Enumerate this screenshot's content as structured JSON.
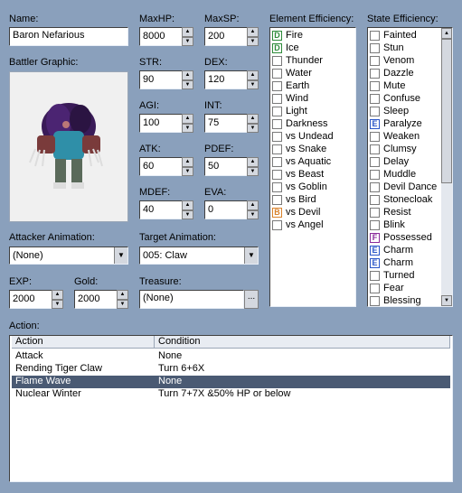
{
  "labels": {
    "name": "Name:",
    "maxhp": "MaxHP:",
    "maxsp": "MaxSP:",
    "element": "Element Efficiency:",
    "state": "State Efficiency:",
    "graphic": "Battler Graphic:",
    "str": "STR:",
    "dex": "DEX:",
    "agi": "AGI:",
    "int": "INT:",
    "atk": "ATK:",
    "pdef": "PDEF:",
    "mdef": "MDEF:",
    "eva": "EVA:",
    "attacker_anim": "Attacker Animation:",
    "target_anim": "Target Animation:",
    "exp": "EXP:",
    "gold": "Gold:",
    "treasure": "Treasure:",
    "action": "Action:"
  },
  "values": {
    "name": "Baron Nefarious",
    "maxhp": "8000",
    "maxsp": "200",
    "str": "90",
    "dex": "120",
    "agi": "100",
    "int": "75",
    "atk": "60",
    "pdef": "50",
    "mdef": "40",
    "eva": "0",
    "attacker_anim": "(None)",
    "target_anim": "005: Claw",
    "exp": "2000",
    "gold": "2000",
    "treasure": "(None)",
    "treasure_button": "..."
  },
  "elements": [
    {
      "label": "Fire",
      "mark": "D",
      "color": "#2e8b3a"
    },
    {
      "label": "Ice",
      "mark": "D",
      "color": "#2e8b3a"
    },
    {
      "label": "Thunder",
      "mark": "",
      "color": ""
    },
    {
      "label": "Water",
      "mark": "",
      "color": ""
    },
    {
      "label": "Earth",
      "mark": "",
      "color": ""
    },
    {
      "label": "Wind",
      "mark": "",
      "color": ""
    },
    {
      "label": "Light",
      "mark": "",
      "color": ""
    },
    {
      "label": "Darkness",
      "mark": "",
      "color": ""
    },
    {
      "label": "vs Undead",
      "mark": "",
      "color": ""
    },
    {
      "label": "vs Snake",
      "mark": "",
      "color": ""
    },
    {
      "label": "vs Aquatic",
      "mark": "",
      "color": ""
    },
    {
      "label": "vs Beast",
      "mark": "",
      "color": ""
    },
    {
      "label": "vs Goblin",
      "mark": "",
      "color": ""
    },
    {
      "label": "vs Bird",
      "mark": "",
      "color": ""
    },
    {
      "label": "vs Devil",
      "mark": "B",
      "color": "#d9822b"
    },
    {
      "label": "vs Angel",
      "mark": "",
      "color": ""
    }
  ],
  "states": [
    {
      "label": "Fainted",
      "mark": "",
      "color": ""
    },
    {
      "label": "Stun",
      "mark": "",
      "color": ""
    },
    {
      "label": "Venom",
      "mark": "",
      "color": ""
    },
    {
      "label": "Dazzle",
      "mark": "",
      "color": ""
    },
    {
      "label": "Mute",
      "mark": "",
      "color": ""
    },
    {
      "label": "Confuse",
      "mark": "",
      "color": ""
    },
    {
      "label": "Sleep",
      "mark": "",
      "color": ""
    },
    {
      "label": "Paralyze",
      "mark": "E",
      "color": "#2a55c8"
    },
    {
      "label": "Weaken",
      "mark": "",
      "color": ""
    },
    {
      "label": "Clumsy",
      "mark": "",
      "color": ""
    },
    {
      "label": "Delay",
      "mark": "",
      "color": ""
    },
    {
      "label": "Muddle",
      "mark": "",
      "color": ""
    },
    {
      "label": "Devil Dance",
      "mark": "",
      "color": ""
    },
    {
      "label": "Stonecloak",
      "mark": "",
      "color": ""
    },
    {
      "label": "Resist",
      "mark": "",
      "color": ""
    },
    {
      "label": "Blink",
      "mark": "",
      "color": ""
    },
    {
      "label": "Possessed",
      "mark": "F",
      "color": "#8a2b9a"
    },
    {
      "label": "Charm",
      "mark": "E",
      "color": "#2a55c8"
    },
    {
      "label": "Charm",
      "mark": "E",
      "color": "#2a55c8"
    },
    {
      "label": "Turned",
      "mark": "",
      "color": ""
    },
    {
      "label": "Fear",
      "mark": "",
      "color": ""
    },
    {
      "label": "Blessing",
      "mark": "",
      "color": ""
    }
  ],
  "actions": {
    "headers": [
      "Action",
      "Condition"
    ],
    "rows": [
      {
        "action": "Attack",
        "condition": "None",
        "selected": false
      },
      {
        "action": "Rending Tiger Claw",
        "condition": "Turn 6+6X",
        "selected": false
      },
      {
        "action": "Flame Wave",
        "condition": "None",
        "selected": true
      },
      {
        "action": "Nuclear Winter",
        "condition": "Turn 7+7X &50% HP or below",
        "selected": false
      }
    ]
  }
}
